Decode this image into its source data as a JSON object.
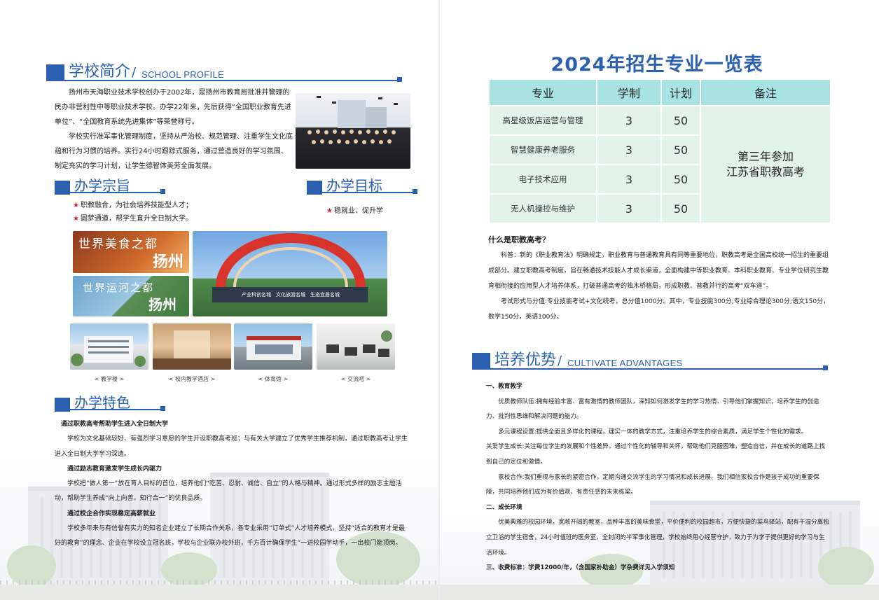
{
  "left": {
    "profile": {
      "title_cn": "学校简介",
      "title_en": "SCHOOL PROFILE",
      "paragraphs": [
        "扬州市天海职业技术学校创办于2002年，是扬州市教育局批准并管理的民办非营利性中等职业技术学校。办学22年来，先后获得“全国职业教育先进单位”、“全国教育系统先进集体”等荣誉称号。",
        "学校实行准军事化管理制度，坚持从严治校、规范管理、注重学生文化底蕴和行为习惯的培养。实行24小时跟踪式服务，通过营造良好的学习氛围、制定充实的学习计划，让学生德智体美劳全面发展。"
      ]
    },
    "purpose": {
      "title_cn": "办学宗旨",
      "items": [
        "职教融合，为社会培养技能型人才；",
        "圆梦通道，帮学生直升全日制大学。"
      ]
    },
    "goal": {
      "title_cn": "办学目标",
      "items": [
        "稳就业、促升学"
      ]
    },
    "banners": {
      "food": "世界美食之都",
      "canal": "世界运河之都",
      "city": "扬州",
      "arch_slogan": "产业科创名城　文化旅游名城　生态宜居名城"
    },
    "photo_captions": [
      "< 教学楼 >",
      "< 校内教学酒店 >",
      "< 体育馆 >",
      "< 交流吧 >"
    ],
    "features": {
      "title_cn": "办学特色",
      "blocks": [
        {
          "heading": "通过职教高考帮助学生进入全日制大学",
          "text": "学校为文化基础较好、有强烈学习意愿的学生开设职教高考班；与有关大学建立了优秀学生推荐机制，通过职教高考让学生进入全日制大学学习深造。"
        },
        {
          "heading": "通过励志教育激发学生成长内驱力",
          "text": "学校把“做人第一”放在育人目标的首位，培养他们“吃苦、忍耐、诚信、自立”的人格与精神。通过形式多样的励志主题活动，帮助学生养成“向上向善，知行合一”的优良品质。"
        },
        {
          "heading": "通过校企合作实现稳定高薪就业",
          "text": "学校多年来与有信誉有实力的知名企业建立了长期合作关系，各专业采用“订单式”人才培养模式，坚持“适合的教育才是最好的教育”的理念、企业在学校设立冠名班，学校与企业联办校外班，千方百计确保学生“一进校园学动手，一出校门能顶岗。"
        }
      ]
    }
  },
  "right": {
    "title": "2024年招生专业一览表",
    "table": {
      "headers": [
        "专业",
        "学制",
        "计划",
        "备注"
      ],
      "rows": [
        {
          "major": "高星级饭店运营与管理",
          "years": "3",
          "plan": "50"
        },
        {
          "major": "智慧健康养老服务",
          "years": "3",
          "plan": "50"
        },
        {
          "major": "电子技术应用",
          "years": "3",
          "plan": "50"
        },
        {
          "major": "无人机操控与维护",
          "years": "3",
          "plan": "50"
        }
      ],
      "note_line1": "第三年参加",
      "note_line2": "江苏省职教高考"
    },
    "exam": {
      "question": "什么是职教高考？",
      "p1": "科普：新的《职业教育法》明确规定，职业教育与普通教育具有同等重要地位，职教高考是全国高校统一招生的重要组成部分。建立职教高考制度，旨在畅通技术技能人才成长渠道，全面构建中等职业教育、本科职业教育、专业学位研究生教育相衔接的应用型人才培养体系，打破普通高考的独木桥格局，形成职教、普教并行的高考“双车道”。",
      "p2": "考试形式与分值:专业技能考试+文化统考，总分值1000分。其中，专业技能300分;专业综合理论300分;语文150分，数学150分，英语100分。"
    },
    "advantages": {
      "title_cn": "培养优势",
      "title_en": "CULTIVATE ADVANTAGES",
      "s1_heading": "一、教育教学",
      "s1_p1": "优质教师队伍:拥有经验丰富、富有激情的教师团队，深知如何激发学生的学习热情、引导他们掌握知识，培养学生的创造力、批判性思维和解决问题的能力。",
      "s1_p2": "多元课程设置:提供全面且多样化的课程，理实一体的教学方式，注重培养学生的综合素质，满足学生个性化的需求。",
      "s1_p3": "关爱学生成长:关注每位学生的发展和个性差异，通过个性化的辅导和关怀，帮助他们克服困难，塑造自信，并在成长的道路上找到自己的定位和激情。",
      "s1_p4": "家校合作:我们重视与家长的紧密合作，定期沟通交流学生的学习情况和成长进展。我们相信家校合作是孩子成功的重要保障，共同培养他们成为有价值观、有责任感的未来栋梁。",
      "s2_heading": "二、成长环境",
      "s2_p1": "优美典雅的校园环境，宽敞开阔的教室，品种丰富的美味食堂，平价便利的校园超市，方便快捷的菜鸟驿站，配有干湿分离独立卫浴的学生宿舍，24小时值班的医务室，全封闭的半军事化管理，学校始终用心经营守护，致力于为学子提供更好的学习与生活环境。",
      "s3_heading": "三、收费标准：学费12000/年，（含国家补助金）学杂费详见入学须知"
    }
  }
}
